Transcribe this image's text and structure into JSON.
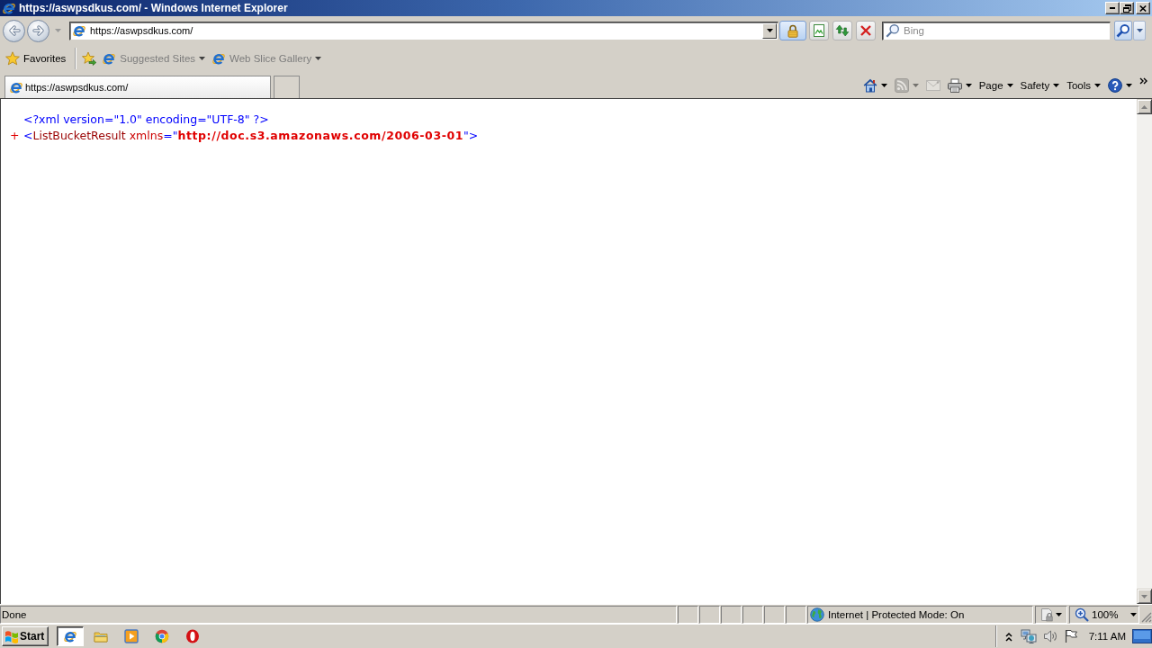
{
  "window": {
    "title": "https://aswpsdkus.com/ - Windows Internet Explorer"
  },
  "address_bar": {
    "url": "https://aswpsdkus.com/"
  },
  "search": {
    "placeholder": "Bing"
  },
  "favorites_bar": {
    "label": "Favorites",
    "items": [
      {
        "label": "Suggested Sites",
        "disabled": true
      },
      {
        "label": "Web Slice Gallery",
        "disabled": true
      }
    ]
  },
  "tabs": [
    {
      "label": "https://aswpsdkus.com/",
      "selected": true
    }
  ],
  "command_bar": {
    "tools": [
      {
        "kind": "home",
        "disabled": false,
        "dropdown": true
      },
      {
        "kind": "feeds",
        "disabled": true,
        "dropdown": true
      },
      {
        "kind": "mail",
        "disabled": true
      },
      {
        "kind": "print",
        "disabled": false,
        "dropdown": true
      }
    ],
    "menus": [
      "Page",
      "Safety",
      "Tools"
    ]
  },
  "document": {
    "lines": [
      {
        "tokens": [
          {
            "kind": "pi",
            "text": "<?xml version=\"1.0\" encoding=\"UTF-8\" ?>"
          }
        ]
      },
      {
        "expander": "+",
        "tokens": [
          {
            "kind": "markup",
            "text": "<"
          },
          {
            "kind": "tag",
            "text": "ListBucketResult"
          },
          {
            "kind": "attr",
            "text": " xmlns"
          },
          {
            "kind": "markup",
            "text": "=\""
          },
          {
            "kind": "ns",
            "text": "http://doc.s3.amazonaws.com/2006-03-01"
          },
          {
            "kind": "markup",
            "text": "\">"
          }
        ]
      }
    ]
  },
  "status_bar": {
    "text": "Done",
    "zone": "Internet | Protected Mode: On",
    "zoom": "100%"
  },
  "taskbar": {
    "start": "Start",
    "apps": [
      {
        "kind": "ie",
        "selected": true
      },
      {
        "kind": "folder",
        "selected": false
      },
      {
        "kind": "media",
        "selected": false
      },
      {
        "kind": "chrome",
        "selected": false
      },
      {
        "kind": "opera",
        "selected": false
      }
    ],
    "clock": "7:11 AM"
  }
}
